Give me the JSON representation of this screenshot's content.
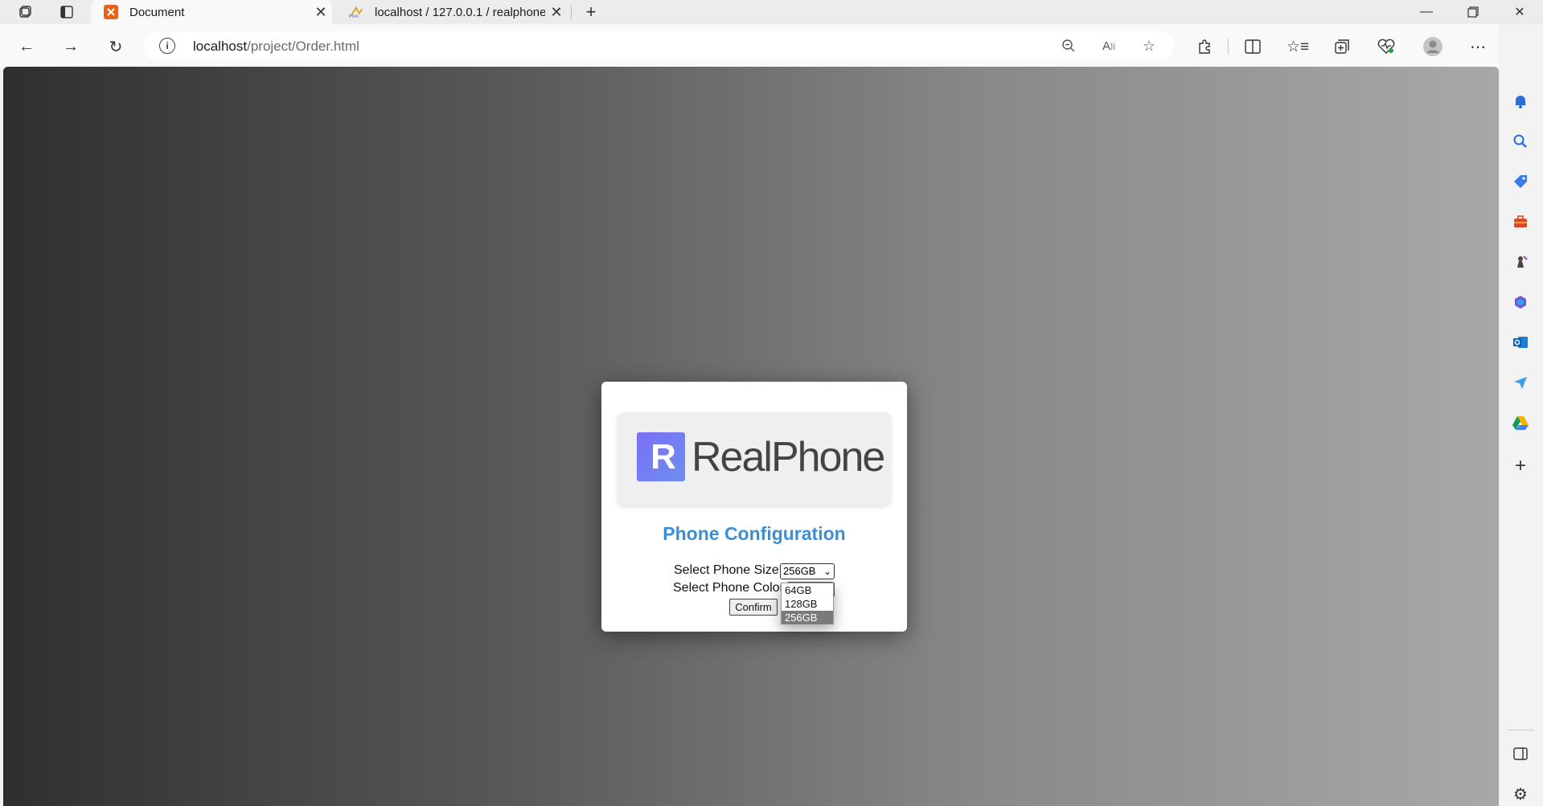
{
  "browser": {
    "tabs": [
      {
        "title": "Document",
        "favicon_color": "#e8621c"
      },
      {
        "title": "localhost / 127.0.0.1 / realphone",
        "favicon_color": "#e0a020"
      }
    ],
    "url_host": "localhost",
    "url_path": "/project/Order.html"
  },
  "page": {
    "logo_mark": "R",
    "logo_text": "RealPhone",
    "title": "Phone Configuration",
    "size_label": "Select Phone Size:",
    "size_value": "256GB",
    "color_label": "Select Phone Color",
    "confirm_label": "Confirm",
    "size_options": [
      "64GB",
      "128GB",
      "256GB"
    ],
    "title_color": "#3a8fd6"
  }
}
